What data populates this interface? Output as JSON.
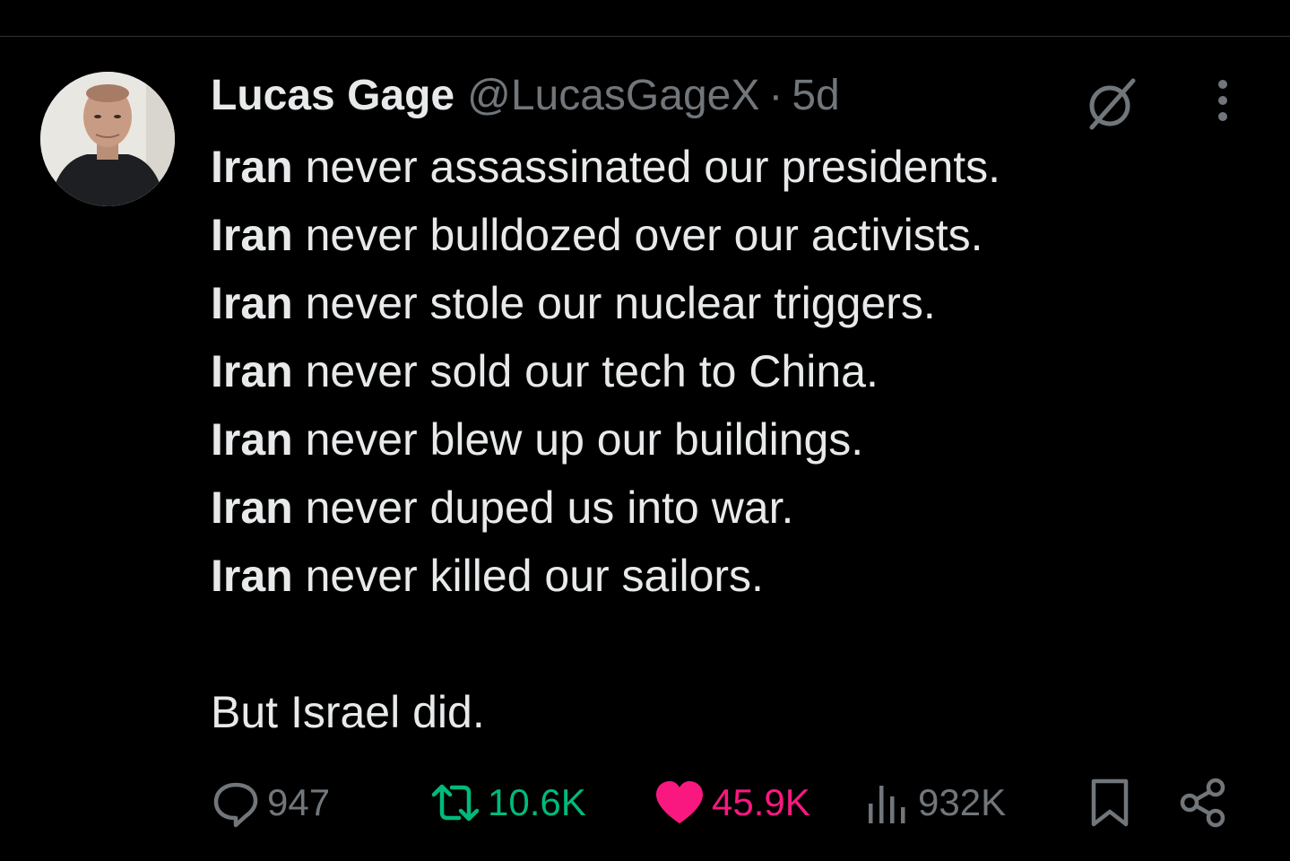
{
  "tweet": {
    "author": {
      "display_name": "Lucas Gage",
      "handle": "@LucasGageX",
      "separator": "·",
      "time": "5d"
    },
    "lines": [
      {
        "bold": "Iran",
        "rest": " never assassinated our presidents."
      },
      {
        "bold": "Iran",
        "rest": " never bulldozed over our activists."
      },
      {
        "bold": "Iran",
        "rest": " never stole our nuclear triggers."
      },
      {
        "bold": "Iran",
        "rest": " never sold our tech to China."
      },
      {
        "bold": "Iran",
        "rest": " never blew up our buildings."
      },
      {
        "bold": "Iran",
        "rest": " never duped us into war."
      },
      {
        "bold": "Iran",
        "rest": " never killed our sailors."
      }
    ],
    "closing": "But Israel did."
  },
  "actions": {
    "replies": "947",
    "reposts": "10.6K",
    "likes": "45.9K",
    "views": "932K"
  },
  "icons": {
    "header": [
      "grok-icon",
      "more-icon"
    ],
    "actions": [
      "reply-icon",
      "retweet-icon",
      "like-icon",
      "views-icon",
      "bookmark-icon",
      "share-icon"
    ]
  },
  "colors": {
    "background": "#000000",
    "text": "#e7e9ea",
    "muted": "#71767b",
    "repost": "#00ba7c",
    "like": "#f91880"
  }
}
